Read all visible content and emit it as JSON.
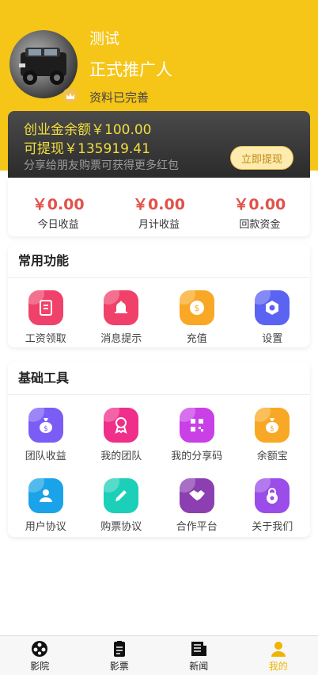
{
  "profile": {
    "name": "测试",
    "role": "正式推广人",
    "status": "资料已完善",
    "avatar_icon": "car-avatar-image",
    "badge_icon": "crown-icon"
  },
  "balance": {
    "startup_fund": "创业金余额￥100.00",
    "withdrawable": "可提现￥135919.41",
    "hint": "分享给朋友购票可获得更多红包",
    "withdraw_button": "立即提现"
  },
  "stats": [
    {
      "value": "￥0.00",
      "label": "今日收益"
    },
    {
      "value": "￥0.00",
      "label": "月计收益"
    },
    {
      "value": "￥0.00",
      "label": "回款资金"
    }
  ],
  "common_functions": {
    "title": "常用功能",
    "items": [
      {
        "label": "工资领取",
        "icon": "wallet-icon",
        "color": "#f0416a"
      },
      {
        "label": "消息提示",
        "icon": "bell-icon",
        "color": "#f0416a"
      },
      {
        "label": "充值",
        "icon": "coin-icon",
        "color": "#f9a825"
      },
      {
        "label": "设置",
        "icon": "gear-icon",
        "color": "#5b63f2"
      }
    ]
  },
  "basic_tools": {
    "title": "基础工具",
    "items": [
      {
        "label": "团队收益",
        "icon": "money-bag-icon",
        "color": "#7b5cf5"
      },
      {
        "label": "我的团队",
        "icon": "award-icon",
        "color": "#ef2f8a"
      },
      {
        "label": "我的分享码",
        "icon": "qrcode-icon",
        "color": "#c840e6"
      },
      {
        "label": "余额宝",
        "icon": "coin-bag-icon",
        "color": "#f9a825"
      },
      {
        "label": "用户协议",
        "icon": "user-icon",
        "color": "#1aa3e8"
      },
      {
        "label": "购票协议",
        "icon": "pencil-icon",
        "color": "#1ccfb8"
      },
      {
        "label": "合作平台",
        "icon": "handshake-icon",
        "color": "#8b3fb0"
      },
      {
        "label": "关于我们",
        "icon": "lock-icon",
        "color": "#9a4de8"
      }
    ]
  },
  "tabbar": [
    {
      "label": "影院",
      "icon": "film-reel-icon",
      "active": false
    },
    {
      "label": "影票",
      "icon": "ticket-icon",
      "active": false
    },
    {
      "label": "新闻",
      "icon": "news-icon",
      "active": false
    },
    {
      "label": "我的",
      "icon": "person-icon",
      "active": true
    }
  ]
}
